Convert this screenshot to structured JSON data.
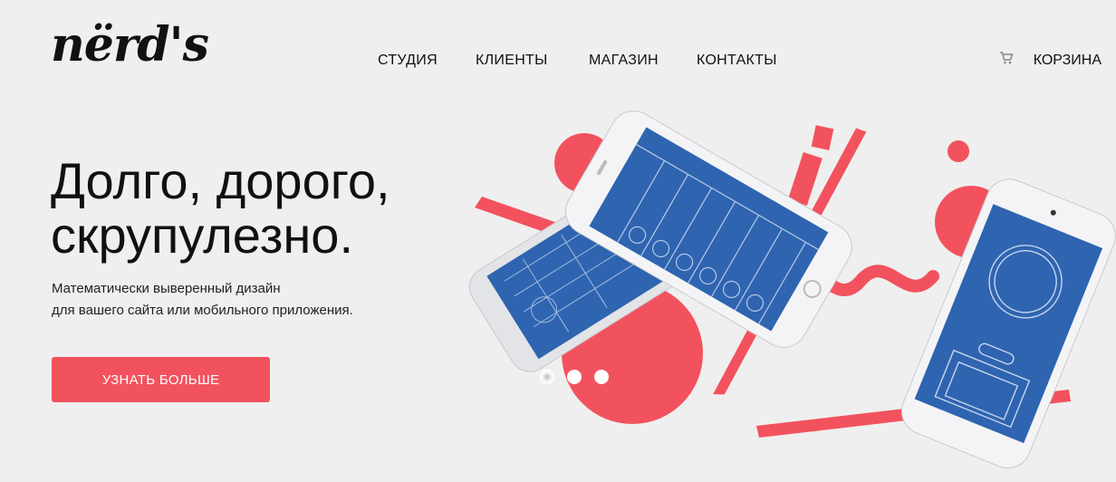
{
  "brand": {
    "logo_text": "nërd's"
  },
  "nav": {
    "items": [
      {
        "label": "СТУДИЯ"
      },
      {
        "label": "КЛИЕНТЫ"
      },
      {
        "label": "МАГАЗИН"
      },
      {
        "label": "КОНТАКТЫ"
      }
    ],
    "cart_label": "КОРЗИНА",
    "cart_icon": "cart-icon"
  },
  "hero": {
    "headline_line1": "Долго, дорого,",
    "headline_line2": "скрупулезно.",
    "subtitle_line1": "Математически выверенный дизайн",
    "subtitle_line2": "для вашего сайта или мобильного приложения.",
    "cta_label": "УЗНАТЬ БОЛЬШЕ"
  },
  "slider": {
    "count": 3,
    "active": 1
  },
  "colors": {
    "accent": "#f2525e",
    "phone_screen": "#2f64b0",
    "background": "#efefef"
  }
}
